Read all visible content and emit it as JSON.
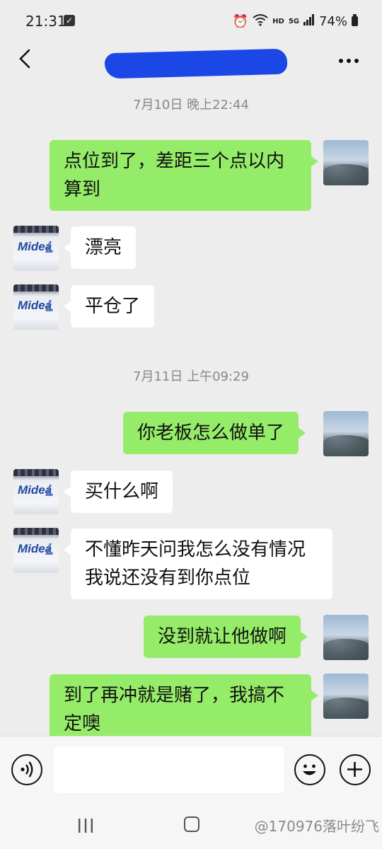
{
  "status_bar": {
    "time": "21:31",
    "network": "5G",
    "hd": "HD",
    "battery": "74%"
  },
  "header": {
    "title": "",
    "back_icon": "chevron-left-icon",
    "more_icon": "more-dots-icon"
  },
  "messages": [
    {
      "type": "timestamp",
      "text": "7月10日 晚上22:44"
    },
    {
      "type": "msg",
      "side": "self",
      "lines": [
        "点位到了，差距三个点以内",
        "算到"
      ]
    },
    {
      "type": "msg",
      "side": "other",
      "lines": [
        "漂亮"
      ],
      "avatar_text": "Midea"
    },
    {
      "type": "msg",
      "side": "other",
      "lines": [
        "平仓了"
      ],
      "avatar_text": "Midea"
    },
    {
      "type": "timestamp",
      "text": "7月11日 上午09:29"
    },
    {
      "type": "msg",
      "side": "self",
      "lines": [
        "你老板怎么做单了"
      ]
    },
    {
      "type": "msg",
      "side": "other",
      "lines": [
        "买什么啊"
      ],
      "avatar_text": "Midea"
    },
    {
      "type": "msg",
      "side": "other",
      "lines": [
        "不懂昨天问我怎么没有情况",
        "我说还没有到你点位"
      ],
      "avatar_text": "Midea"
    },
    {
      "type": "msg",
      "side": "self",
      "lines": [
        "没到就让他做啊"
      ]
    },
    {
      "type": "msg",
      "side": "self",
      "lines": [
        "到了再冲就是赌了，我搞不",
        "定噢"
      ]
    }
  ],
  "input_bar": {
    "placeholder": "",
    "voice_icon": "voice-icon",
    "emoji_icon": "emoji-icon",
    "plus_icon": "plus-icon"
  },
  "watermark": "@170976落叶纷飞",
  "colors": {
    "background": "#ededed",
    "self_bubble": "#95ec69",
    "other_bubble": "#ffffff",
    "timestamp_text": "#888888",
    "redaction": "#1b47e6"
  }
}
